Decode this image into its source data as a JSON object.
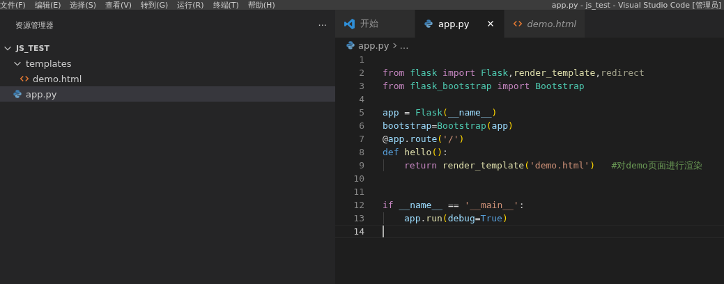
{
  "menu": [
    "文件(F)",
    "编辑(E)",
    "选择(S)",
    "查看(V)",
    "转到(G)",
    "运行(R)",
    "终端(T)",
    "帮助(H)"
  ],
  "window": {
    "title": "app.py - js_test - Visual Studio Code [管理员]"
  },
  "sidebar": {
    "title": "资源管理器",
    "more": "···",
    "tree": [
      {
        "label": "JS_TEST",
        "kind": "root",
        "expanded": true,
        "selected": false,
        "children": [
          {
            "label": "templates",
            "kind": "folder",
            "expanded": true,
            "selected": false,
            "children": [
              {
                "label": "demo.html",
                "kind": "html",
                "selected": false
              }
            ]
          },
          {
            "label": "app.py",
            "kind": "python",
            "selected": true
          }
        ]
      }
    ]
  },
  "tabs": [
    {
      "label": "开始",
      "kind": "vscode",
      "selected": false,
      "preview": false,
      "closable": false
    },
    {
      "label": "app.py",
      "kind": "python",
      "selected": true,
      "preview": false,
      "closable": true
    },
    {
      "label": "demo.html",
      "kind": "html",
      "selected": false,
      "preview": true,
      "closable": false
    }
  ],
  "breadcrumb": {
    "file": "app.py",
    "rest": "…"
  },
  "editor": {
    "lines": [
      {
        "number": "1",
        "guide": false,
        "current": false
      },
      {
        "number": "2",
        "guide": false,
        "current": false,
        "tokens": [
          {
            "t": "from ",
            "kind": "kw"
          },
          {
            "t": "flask ",
            "kind": "mod"
          },
          {
            "t": "import ",
            "kind": "kw"
          },
          {
            "t": "Flask",
            "kind": "mod"
          },
          {
            "t": ",",
            "kind": "plain"
          },
          {
            "t": "render_template",
            "kind": "func"
          },
          {
            "t": ",",
            "kind": "plain"
          },
          {
            "t": "redirect",
            "kind": "faded"
          }
        ]
      },
      {
        "number": "3",
        "guide": false,
        "current": false,
        "tokens": [
          {
            "t": "from ",
            "kind": "kw"
          },
          {
            "t": "flask_bootstrap ",
            "kind": "mod"
          },
          {
            "t": "import ",
            "kind": "kw"
          },
          {
            "t": "Bootstrap",
            "kind": "mod"
          }
        ]
      },
      {
        "number": "4",
        "guide": false,
        "current": false
      },
      {
        "number": "5",
        "guide": false,
        "current": false,
        "tokens": [
          {
            "t": "app",
            "kind": "var"
          },
          {
            "t": " = ",
            "kind": "plain"
          },
          {
            "t": "Flask",
            "kind": "mod"
          },
          {
            "t": "(",
            "kind": "paren"
          },
          {
            "t": "__name__",
            "kind": "var"
          },
          {
            "t": ")",
            "kind": "paren"
          }
        ]
      },
      {
        "number": "6",
        "guide": false,
        "current": false,
        "tokens": [
          {
            "t": "bootstrap",
            "kind": "var"
          },
          {
            "t": "=",
            "kind": "plain"
          },
          {
            "t": "Bootstrap",
            "kind": "mod"
          },
          {
            "t": "(",
            "kind": "paren"
          },
          {
            "t": "app",
            "kind": "var"
          },
          {
            "t": ")",
            "kind": "paren"
          }
        ]
      },
      {
        "number": "7",
        "guide": false,
        "current": false,
        "tokens": [
          {
            "t": "@",
            "kind": "plain"
          },
          {
            "t": "app",
            "kind": "var"
          },
          {
            "t": ".",
            "kind": "plain"
          },
          {
            "t": "route",
            "kind": "var"
          },
          {
            "t": "(",
            "kind": "paren"
          },
          {
            "t": "'/'",
            "kind": "str"
          },
          {
            "t": ")",
            "kind": "paren"
          }
        ]
      },
      {
        "number": "8",
        "guide": false,
        "current": false,
        "tokens": [
          {
            "t": "def ",
            "kind": "def"
          },
          {
            "t": "hello",
            "kind": "func"
          },
          {
            "t": "(",
            "kind": "paren"
          },
          {
            "t": ")",
            "kind": "paren"
          },
          {
            "t": ":",
            "kind": "plain"
          }
        ]
      },
      {
        "number": "9",
        "guide": true,
        "current": false,
        "tokens": [
          {
            "t": "return ",
            "kind": "kw"
          },
          {
            "t": "render_template",
            "kind": "func"
          },
          {
            "t": "(",
            "kind": "paren"
          },
          {
            "t": "'demo.html'",
            "kind": "str"
          },
          {
            "t": ")",
            "kind": "paren"
          },
          {
            "t": "   #对demo页面进行渲染",
            "kind": "comment"
          }
        ]
      },
      {
        "number": "10",
        "guide": false,
        "current": false
      },
      {
        "number": "11",
        "guide": false,
        "current": false
      },
      {
        "number": "12",
        "guide": false,
        "current": false,
        "tokens": [
          {
            "t": "if ",
            "kind": "kw"
          },
          {
            "t": "__name__",
            "kind": "var"
          },
          {
            "t": " == ",
            "kind": "plain"
          },
          {
            "t": "'__main__'",
            "kind": "str"
          },
          {
            "t": ":",
            "kind": "plain"
          }
        ]
      },
      {
        "number": "13",
        "guide": true,
        "current": false,
        "tokens": [
          {
            "t": "app",
            "kind": "var"
          },
          {
            "t": ".",
            "kind": "plain"
          },
          {
            "t": "run",
            "kind": "func"
          },
          {
            "t": "(",
            "kind": "paren"
          },
          {
            "t": "debug",
            "kind": "var"
          },
          {
            "t": "=",
            "kind": "plain"
          },
          {
            "t": "True",
            "kind": "def"
          },
          {
            "t": ")",
            "kind": "paren"
          }
        ]
      },
      {
        "number": "14",
        "guide": false,
        "current": true
      }
    ]
  }
}
